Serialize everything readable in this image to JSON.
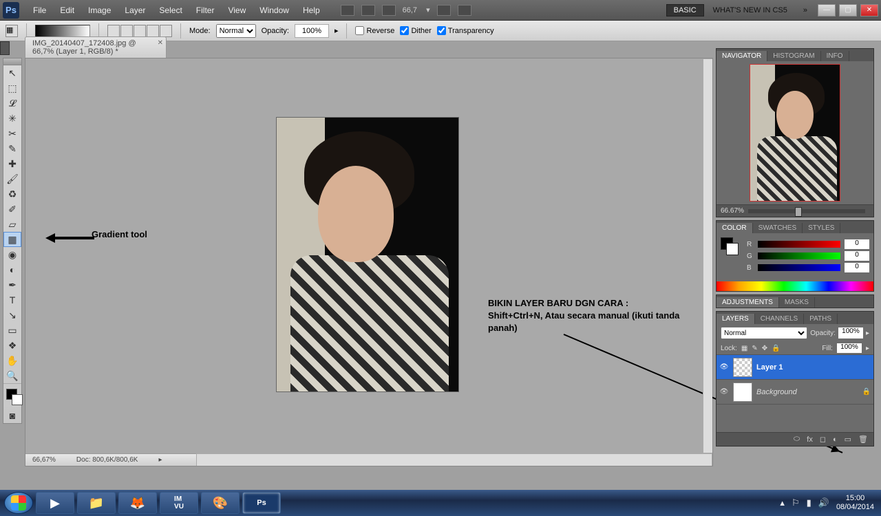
{
  "menubar": {
    "logo": "Ps",
    "items": [
      "File",
      "Edit",
      "Image",
      "Layer",
      "Select",
      "Filter",
      "View",
      "Window",
      "Help"
    ],
    "zoom_value": "66,7",
    "basic": "BASIC",
    "whatsnew": "WHAT'S NEW IN CS5",
    "chev": "»"
  },
  "options": {
    "mode_label": "Mode:",
    "mode_value": "Normal",
    "opacity_label": "Opacity:",
    "opacity_value": "100%",
    "reverse": "Reverse",
    "dither": "Dither",
    "transparency": "Transparency"
  },
  "doctab": {
    "title": "IMG_20140407_172408.jpg @ 66,7% (Layer 1, RGB/8) *"
  },
  "tools": [
    {
      "name": "move",
      "glyph": "↖"
    },
    {
      "name": "marquee",
      "glyph": "⬚"
    },
    {
      "name": "lasso",
      "glyph": "𝓛"
    },
    {
      "name": "wand",
      "glyph": "✳"
    },
    {
      "name": "crop",
      "glyph": "✂"
    },
    {
      "name": "eyedrop",
      "glyph": "✎"
    },
    {
      "name": "heal",
      "glyph": "✚"
    },
    {
      "name": "brush",
      "glyph": "🖌"
    },
    {
      "name": "stamp",
      "glyph": "♻"
    },
    {
      "name": "history",
      "glyph": "✐"
    },
    {
      "name": "eraser",
      "glyph": "▱"
    },
    {
      "name": "gradient",
      "glyph": "▦",
      "selected": true
    },
    {
      "name": "blur",
      "glyph": "◉"
    },
    {
      "name": "dodge",
      "glyph": "◐"
    },
    {
      "name": "pen",
      "glyph": "✒"
    },
    {
      "name": "type",
      "glyph": "T"
    },
    {
      "name": "path",
      "glyph": "↘"
    },
    {
      "name": "shape",
      "glyph": "▭"
    },
    {
      "name": "3d",
      "glyph": "❖"
    },
    {
      "name": "hand",
      "glyph": "✋"
    },
    {
      "name": "zoom",
      "glyph": "🔍"
    }
  ],
  "annotations": {
    "gradient": "Gradient tool",
    "newlayer1": "BIKIN LAYER BARU DGN CARA :",
    "newlayer2": "Shift+Ctrl+N, Atau secara manual (ikuti tanda panah)"
  },
  "status": {
    "zoom": "66,67%",
    "doc": "Doc: 800,6K/800,6K"
  },
  "panels": {
    "navigator": {
      "tabs": [
        "NAVIGATOR",
        "HISTOGRAM",
        "INFO"
      ],
      "zoom": "66.67%"
    },
    "color": {
      "tabs": [
        "COLOR",
        "SWATCHES",
        "STYLES"
      ],
      "r_label": "R",
      "r_val": "0",
      "g_label": "G",
      "g_val": "0",
      "b_label": "B",
      "b_val": "0"
    },
    "adjustments": {
      "tabs": [
        "ADJUSTMENTS",
        "MASKS"
      ]
    },
    "layers": {
      "tabs": [
        "LAYERS",
        "CHANNELS",
        "PATHS"
      ],
      "blend": "Normal",
      "opacity_label": "Opacity:",
      "opacity_val": "100%",
      "lock_label": "Lock:",
      "fill_label": "Fill:",
      "fill_val": "100%",
      "rows": [
        {
          "name": "Layer 1",
          "selected": true,
          "locked": false,
          "italic": false
        },
        {
          "name": "Background",
          "selected": false,
          "locked": true,
          "italic": true
        }
      ],
      "foot_icons": [
        "⬭",
        "fx",
        "◻",
        "◐",
        "▭",
        "🗑"
      ]
    }
  },
  "taskbar": {
    "time": "15:00",
    "date": "08/04/2014"
  }
}
